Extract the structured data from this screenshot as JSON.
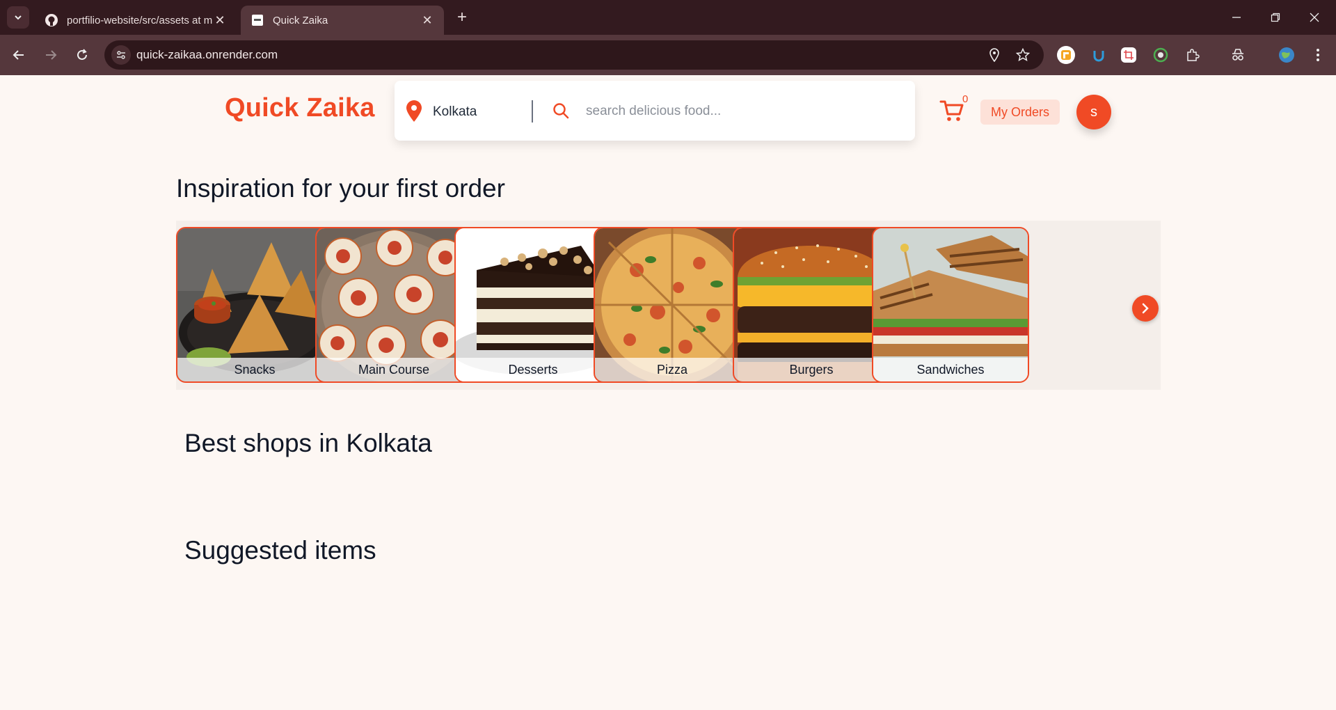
{
  "browser": {
    "tabs": [
      {
        "title": "portfilio-website/src/assets at m",
        "favicon": "github-icon"
      },
      {
        "title": "Quick Zaika",
        "favicon": "site-favicon"
      }
    ],
    "url": "quick-zaikaa.onrender.com"
  },
  "header": {
    "logo": "Quick Zaika",
    "location": "Kolkata",
    "search_placeholder": "search delicious food...",
    "cart_count": "0",
    "my_orders_label": "My Orders",
    "avatar_initial": "s"
  },
  "sections": {
    "inspiration_title": "Inspiration for your first order",
    "best_shops_title": "Best shops in Kolkata",
    "suggested_title": "Suggested items"
  },
  "categories": [
    {
      "label": "Snacks"
    },
    {
      "label": "Main Course"
    },
    {
      "label": "Desserts"
    },
    {
      "label": "Pizza"
    },
    {
      "label": "Burgers"
    },
    {
      "label": "Sandwiches"
    }
  ],
  "colors": {
    "brand": "#f04a25",
    "page_bg": "#fdf7f3",
    "chrome_dark": "#331a1f",
    "chrome_toolbar": "#55373c"
  }
}
